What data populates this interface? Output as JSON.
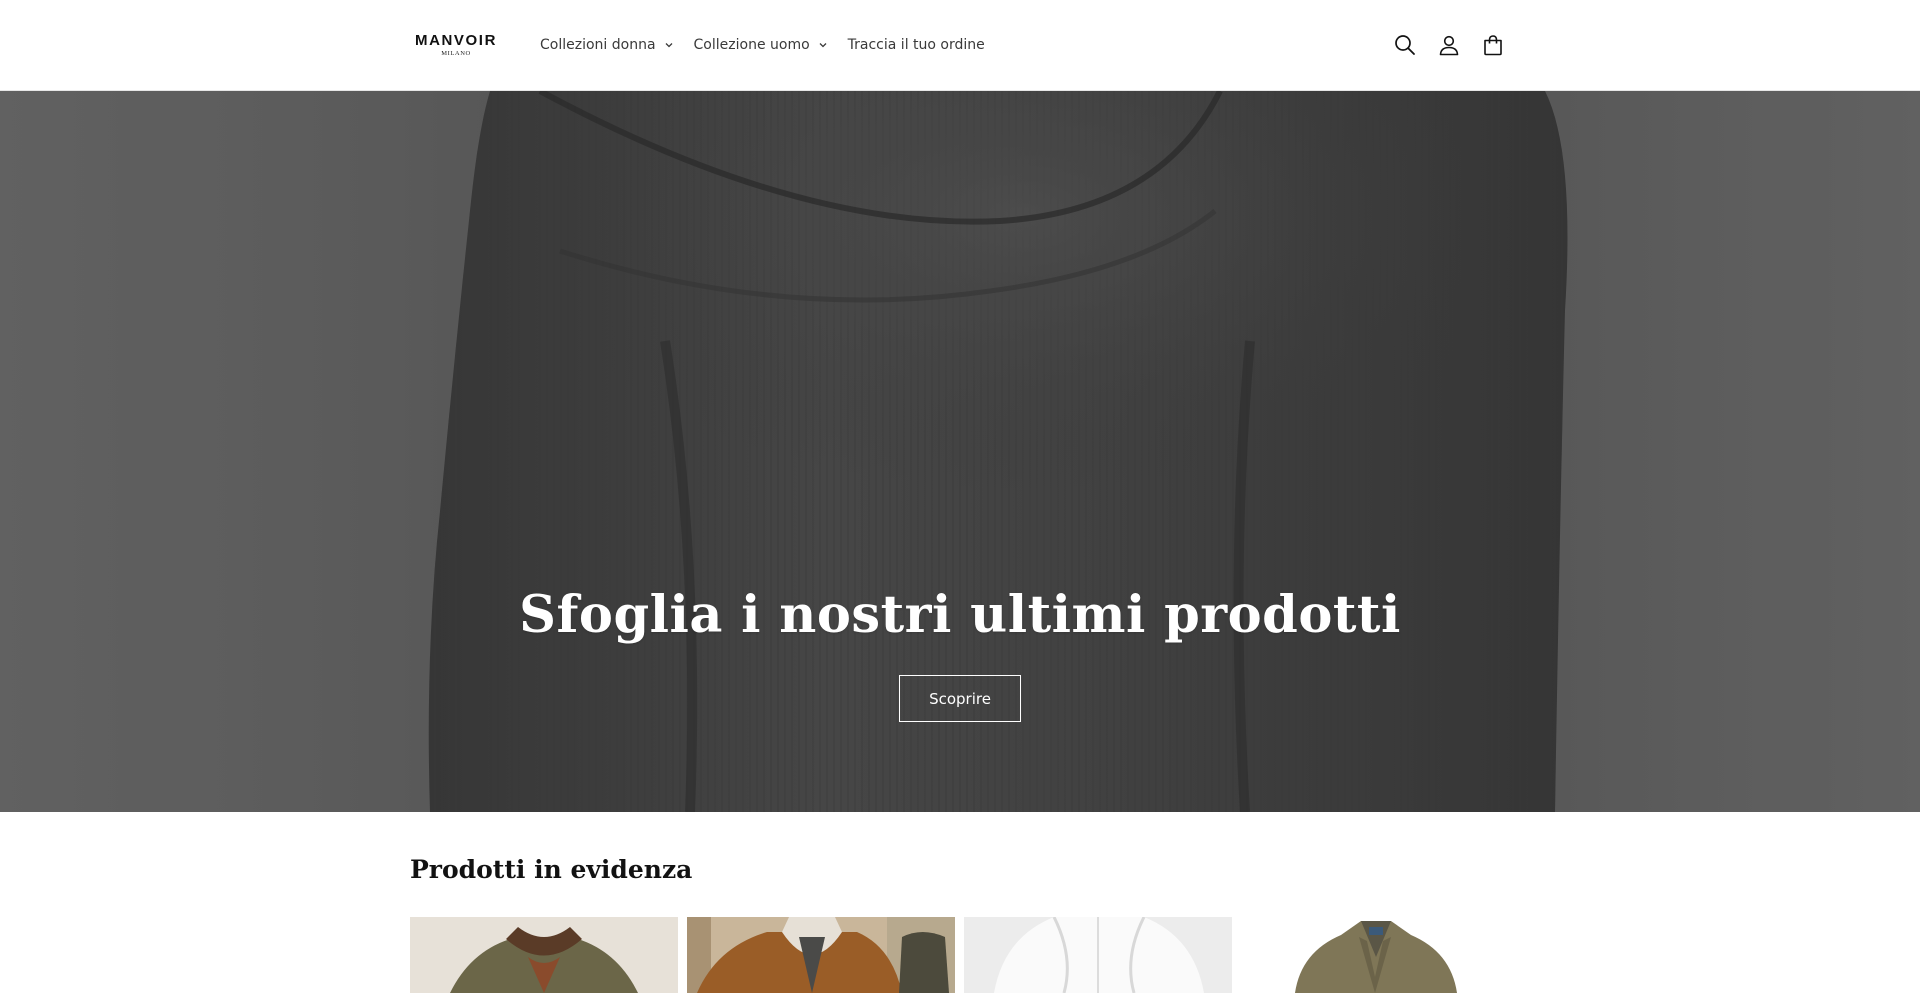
{
  "brand": {
    "name": "MANVOIR",
    "subtitle": "MILANO"
  },
  "nav": {
    "items": [
      {
        "label": "Collezioni donna",
        "has_dropdown": true
      },
      {
        "label": "Collezione uomo",
        "has_dropdown": true
      },
      {
        "label": "Traccia il tuo ordine",
        "has_dropdown": false
      }
    ]
  },
  "header_icons": [
    "search-icon",
    "account-icon",
    "cart-icon"
  ],
  "hero": {
    "title": "Sfoglia i nostri ultimi prodotti",
    "button_label": "Scoprire"
  },
  "featured": {
    "title": "Prodotti in evidenza",
    "products": [
      {
        "image": "olive-corduroy-jacket-with-fur-collar"
      },
      {
        "image": "brown-suede-jacket-with-scarf"
      },
      {
        "image": "white-shirt"
      },
      {
        "image": "olive-blazer-jacket"
      }
    ]
  },
  "colors": {
    "text": "#121212",
    "nav_text": "#3a3a3a",
    "hero_text": "#ffffff",
    "background": "#ffffff"
  }
}
